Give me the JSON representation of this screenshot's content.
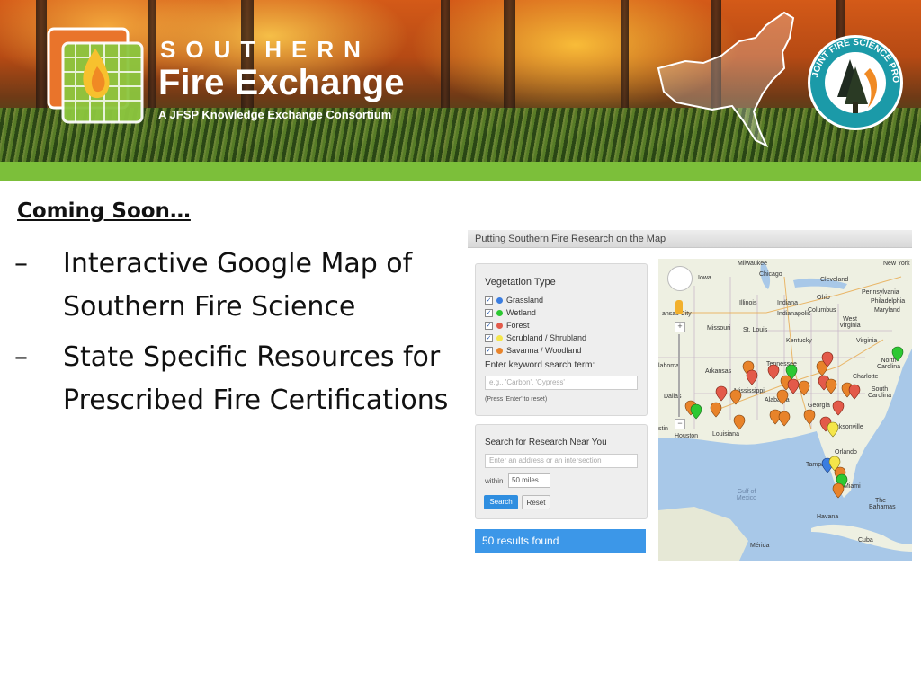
{
  "banner": {
    "brand_line1": "SOUTHERN",
    "brand_line2": "Fire Exchange",
    "tagline": "A JFSP Knowledge Exchange Consortium",
    "jfsp_ring_text": "JOINT FIRE SCIENCE PROGRAM",
    "accent_green": "#7cbf3a"
  },
  "slide": {
    "heading": "Coming Soon…",
    "bullets": [
      {
        "dash": "–",
        "text": "Interactive Google Map of Southern Fire Science"
      },
      {
        "dash": "–",
        "text": "State Specific Resources for Prescribed Fire Certifications"
      }
    ]
  },
  "widget": {
    "title": "Putting Southern Fire Research on the Map",
    "vegetation_heading": "Vegetation Type",
    "vegetation_types": [
      {
        "label": "Grassland",
        "color": "#3b7de0",
        "checked": true
      },
      {
        "label": "Wetland",
        "color": "#2cc832",
        "checked": true
      },
      {
        "label": "Forest",
        "color": "#e35a4a",
        "checked": true
      },
      {
        "label": "Scrubland / Shrubland",
        "color": "#f5e64a",
        "checked": true
      },
      {
        "label": "Savanna / Woodland",
        "color": "#e8832a",
        "checked": true
      }
    ],
    "keyword_label": "Enter keyword search term:",
    "keyword_placeholder": "e.g., 'Carbon', 'Cypress'",
    "keyword_hint": "(Press 'Enter' to reset)",
    "near_heading": "Search for Research Near You",
    "address_placeholder": "Enter an address or an intersection",
    "within_label": "within",
    "distance_value": "50 miles",
    "search_button": "Search",
    "reset_button": "Reset",
    "results_text": "50 results found",
    "map_labels": {
      "milwaukee": "Milwaukee",
      "chicago": "Chicago",
      "iowa": "Iowa",
      "cleveland": "Cleveland",
      "new_york": "New York",
      "illinois": "Illinois",
      "indiana": "Indiana",
      "ohio": "Ohio",
      "pennsylvania": "Pennsylvania",
      "philadelphia": "Philadelphia",
      "kansas_city": "ansas City",
      "indianapolis": "Indianapolis",
      "columbus": "Columbus",
      "maryland": "Maryland",
      "missouri": "Missouri",
      "st_louis": "St. Louis",
      "west_virginia": "West Virginia",
      "kentucky": "Kentucky",
      "virginia": "Virginia",
      "tennessee": "Tennessee",
      "north_carolina": "North Carolina",
      "oklahoma": "lahoma",
      "arkansas": "Arkansas",
      "charlotte": "Charlotte",
      "mississippi": "Mississippi",
      "south_carolina": "South Carolina",
      "alabama": "Alabama",
      "georgia": "Georgia",
      "dallas": "Dallas",
      "louisiana": "Louisiana",
      "houston": "Houston",
      "jacksonville": "Jacksonville",
      "orlando": "Orlando",
      "tampa": "Tampa",
      "miami": "Miami",
      "gulf": "Gulf of Mexico",
      "bahamas": "The Bahamas",
      "havana": "Havana",
      "cuba": "Cuba",
      "merida": "Mérida",
      "stin": "stin"
    }
  }
}
